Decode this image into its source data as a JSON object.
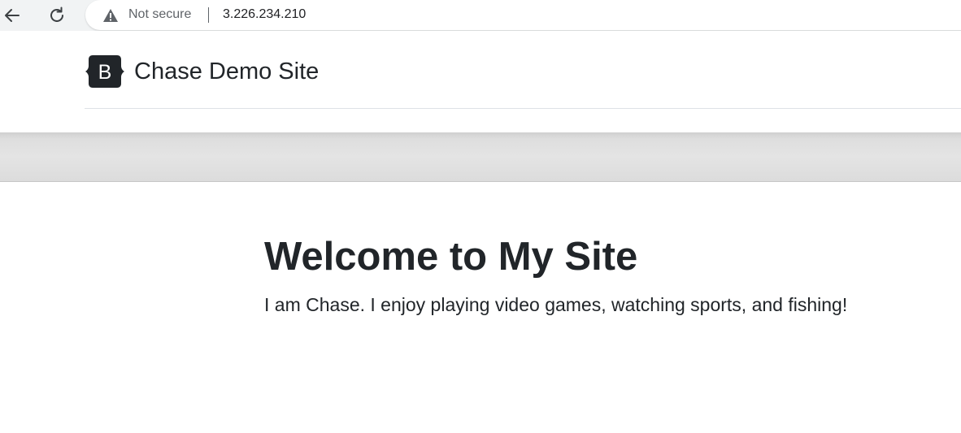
{
  "browser": {
    "security_label": "Not secure",
    "url": "3.226.234.210",
    "icons": {
      "back": "arrow-left-icon",
      "reload": "reload-icon",
      "warning": "warning-triangle-icon"
    }
  },
  "header": {
    "brand_logo_letter": "B",
    "brand_name": "Chase Demo Site"
  },
  "main": {
    "title": "Welcome to My Site",
    "lead": "I am Chase. I enjoy playing video games, watching sports, and fishing!"
  },
  "colors": {
    "text": "#212529",
    "divider": "#dee2e6",
    "band": "#e0e0e0",
    "chrome": "#f1f3f4"
  }
}
